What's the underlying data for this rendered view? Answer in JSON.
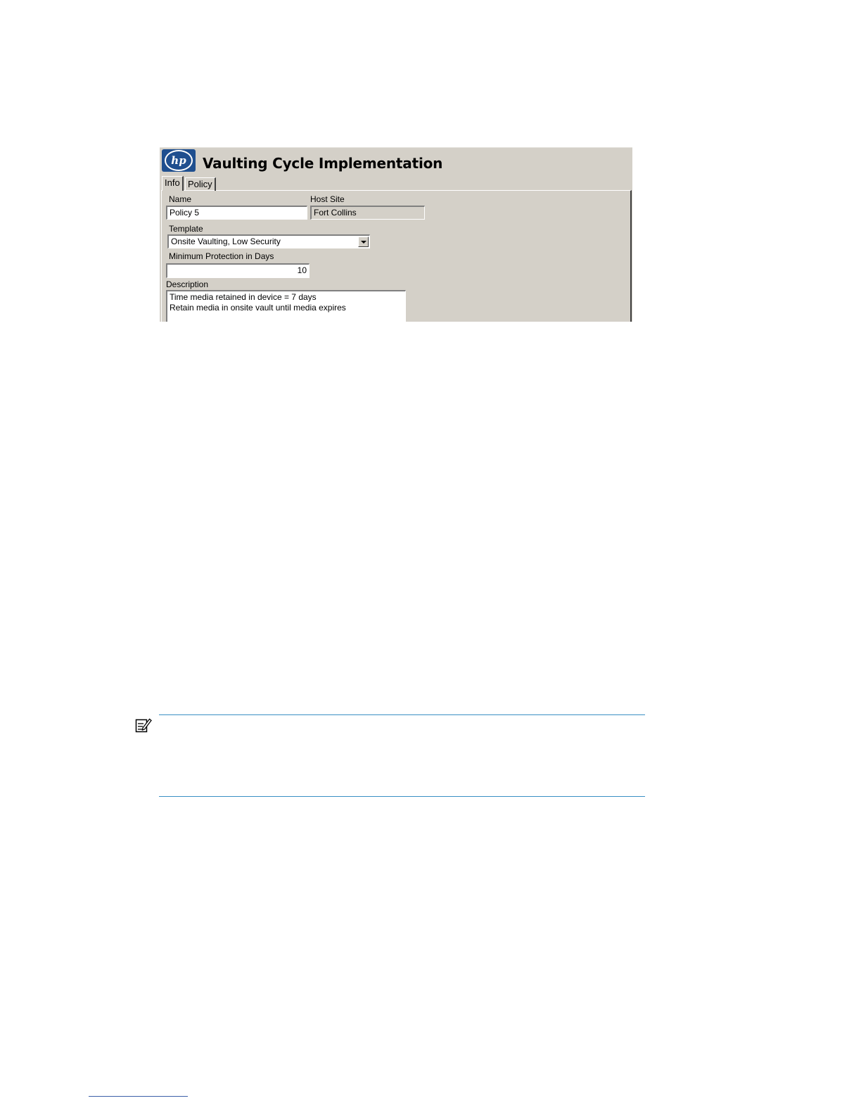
{
  "window": {
    "title": "Vaulting Cycle Implementation",
    "logo_text": "hp"
  },
  "tabs": [
    {
      "label": "Info",
      "selected": true
    },
    {
      "label": "Policy",
      "selected": false
    }
  ],
  "form": {
    "name_label": "Name",
    "name_value": "Policy 5",
    "host_site_label": "Host Site",
    "host_site_value": "Fort Collins",
    "template_label": "Template",
    "template_value": "Onsite Vaulting, Low Security",
    "min_protection_label": "Minimum Protection in Days",
    "min_protection_value": "10",
    "description_label": "Description",
    "description_lines": [
      "Time media retained in device = 7 days",
      "Retain media in onsite vault until media expires"
    ]
  },
  "note": {
    "icon": "note-icon"
  },
  "colors": {
    "dialog_background": "#d4d0c8",
    "hp_blue": "#1f4f8f",
    "note_rule": "#3a8fc4"
  }
}
